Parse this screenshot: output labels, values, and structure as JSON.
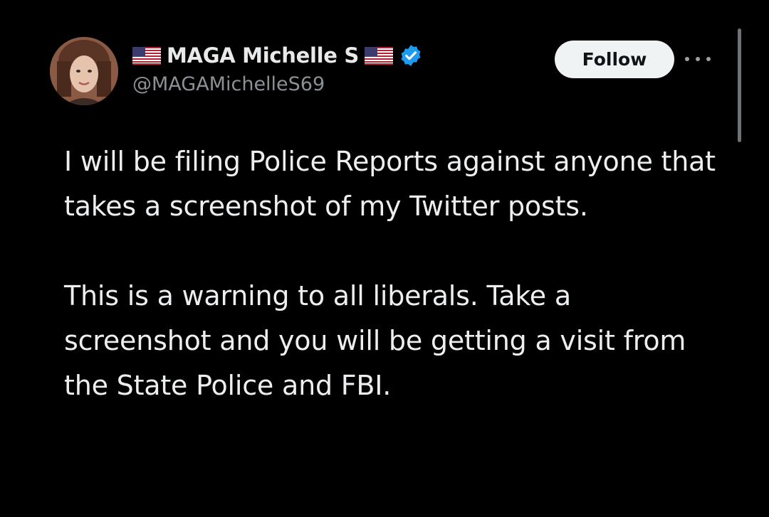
{
  "author": {
    "display_name": "MAGA Michelle S",
    "handle": "@MAGAMichelleS69",
    "verified": true,
    "flag_icon": "us-flag-icon",
    "verified_icon": "verified-badge-icon"
  },
  "actions": {
    "follow_label": "Follow",
    "more_icon": "more-options-icon"
  },
  "tweet": {
    "paragraphs": [
      "I will be filing Police Reports against anyone that takes a screenshot of my Twitter posts.",
      "This is a warning to all liberals. Take a screenshot and you will be getting a visit from the State Police and FBI."
    ]
  },
  "colors": {
    "background": "#000000",
    "text_primary": "#e7e9ea",
    "text_secondary": "#8b9096",
    "verified_blue": "#1d9bf0",
    "follow_button_bg": "#eff3f4"
  }
}
